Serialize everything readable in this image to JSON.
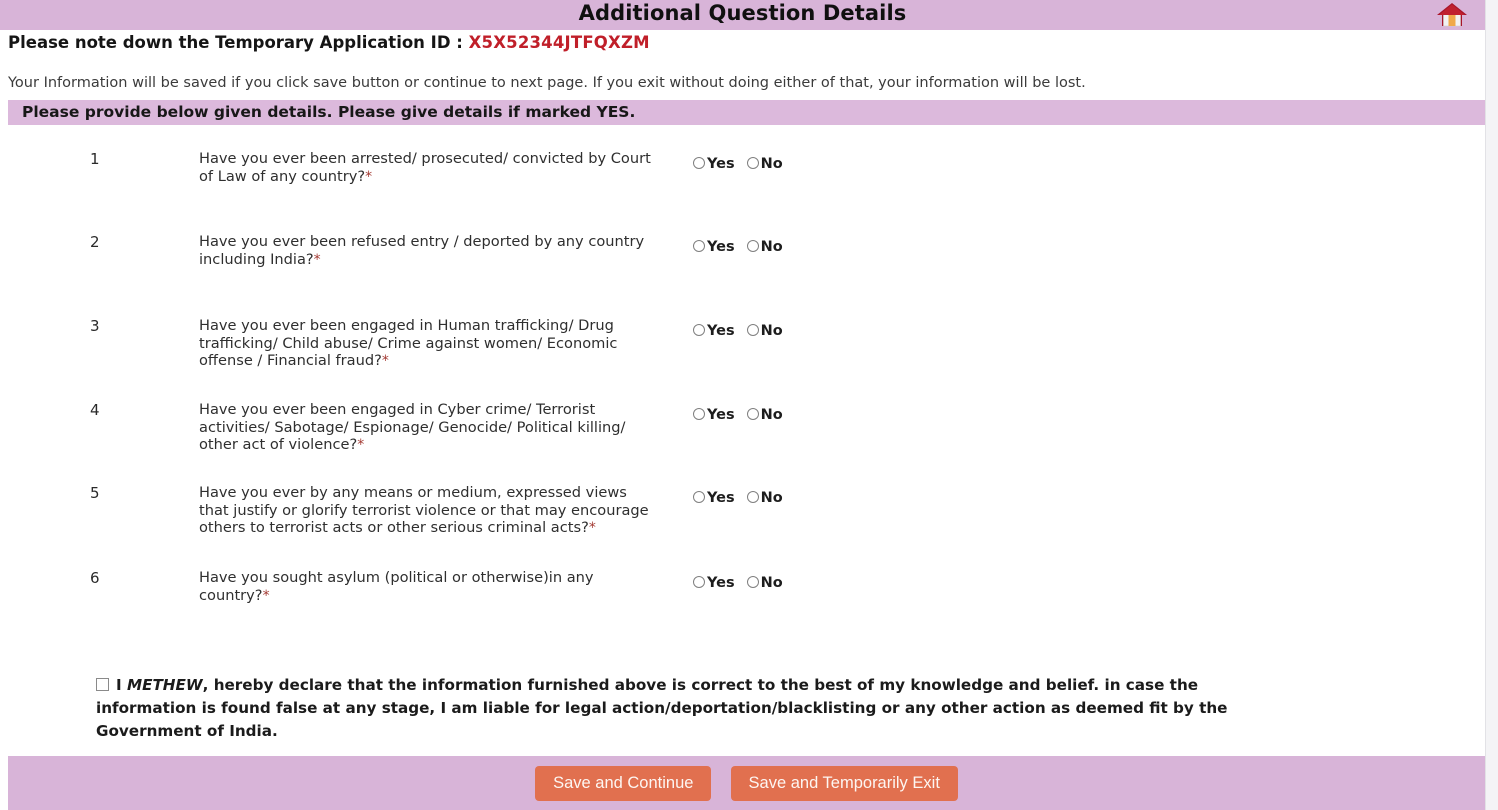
{
  "header": {
    "title": "Additional Question Details",
    "home_icon": "home-icon"
  },
  "appid": {
    "label": "Please note down the Temporary Application ID : ",
    "value": "X5X52344JTFQXZM",
    "value_color": "#c01f29"
  },
  "notice": {
    "text": "Your Information will be saved if you click save button or continue to next page. If you exit without doing either of that, your information will be lost."
  },
  "subtitle": {
    "text": "Please provide below given details. Please give details if marked YES."
  },
  "options": {
    "yes": "Yes",
    "no": "No"
  },
  "questions": [
    {
      "number": "1",
      "text": "Have you ever been arrested/ prosecuted/ convicted by Court of Law of any country?",
      "required": "*",
      "selected": ""
    },
    {
      "number": "2",
      "text": "Have you ever been refused entry / deported by any country including India?",
      "required": "*",
      "selected": ""
    },
    {
      "number": "3",
      "text": "Have you ever been engaged in Human trafficking/ Drug trafficking/ Child abuse/ Crime against women/ Economic offense / Financial fraud?",
      "required": "*",
      "selected": ""
    },
    {
      "number": "4",
      "text": "Have you ever been engaged in Cyber crime/ Terrorist activities/ Sabotage/ Espionage/ Genocide/ Political killing/ other act of violence?",
      "required": "*",
      "selected": ""
    },
    {
      "number": "5",
      "text": "Have you ever by any means or medium, expressed views that justify or glorify terrorist violence or that may encourage others to terrorist acts or other serious criminal acts?",
      "required": "*",
      "selected": ""
    },
    {
      "number": "6",
      "text": "Have you sought asylum (political or otherwise)in any country?",
      "required": "*",
      "selected": ""
    }
  ],
  "declaration": {
    "checked": false,
    "prefix": "I ",
    "name": "METHEW",
    "body": ", hereby declare that the information furnished above is correct to the best of my knowledge and belief. in case the information is found false at any stage, I am liable for legal action/deportation/blacklisting or any other action as deemed fit by the Government of India."
  },
  "footer": {
    "save_continue_label": "Save and Continue",
    "save_exit_label": "Save and Temporarily Exit",
    "button_color": "#e1704f",
    "band_color": "#d8b4d8"
  }
}
